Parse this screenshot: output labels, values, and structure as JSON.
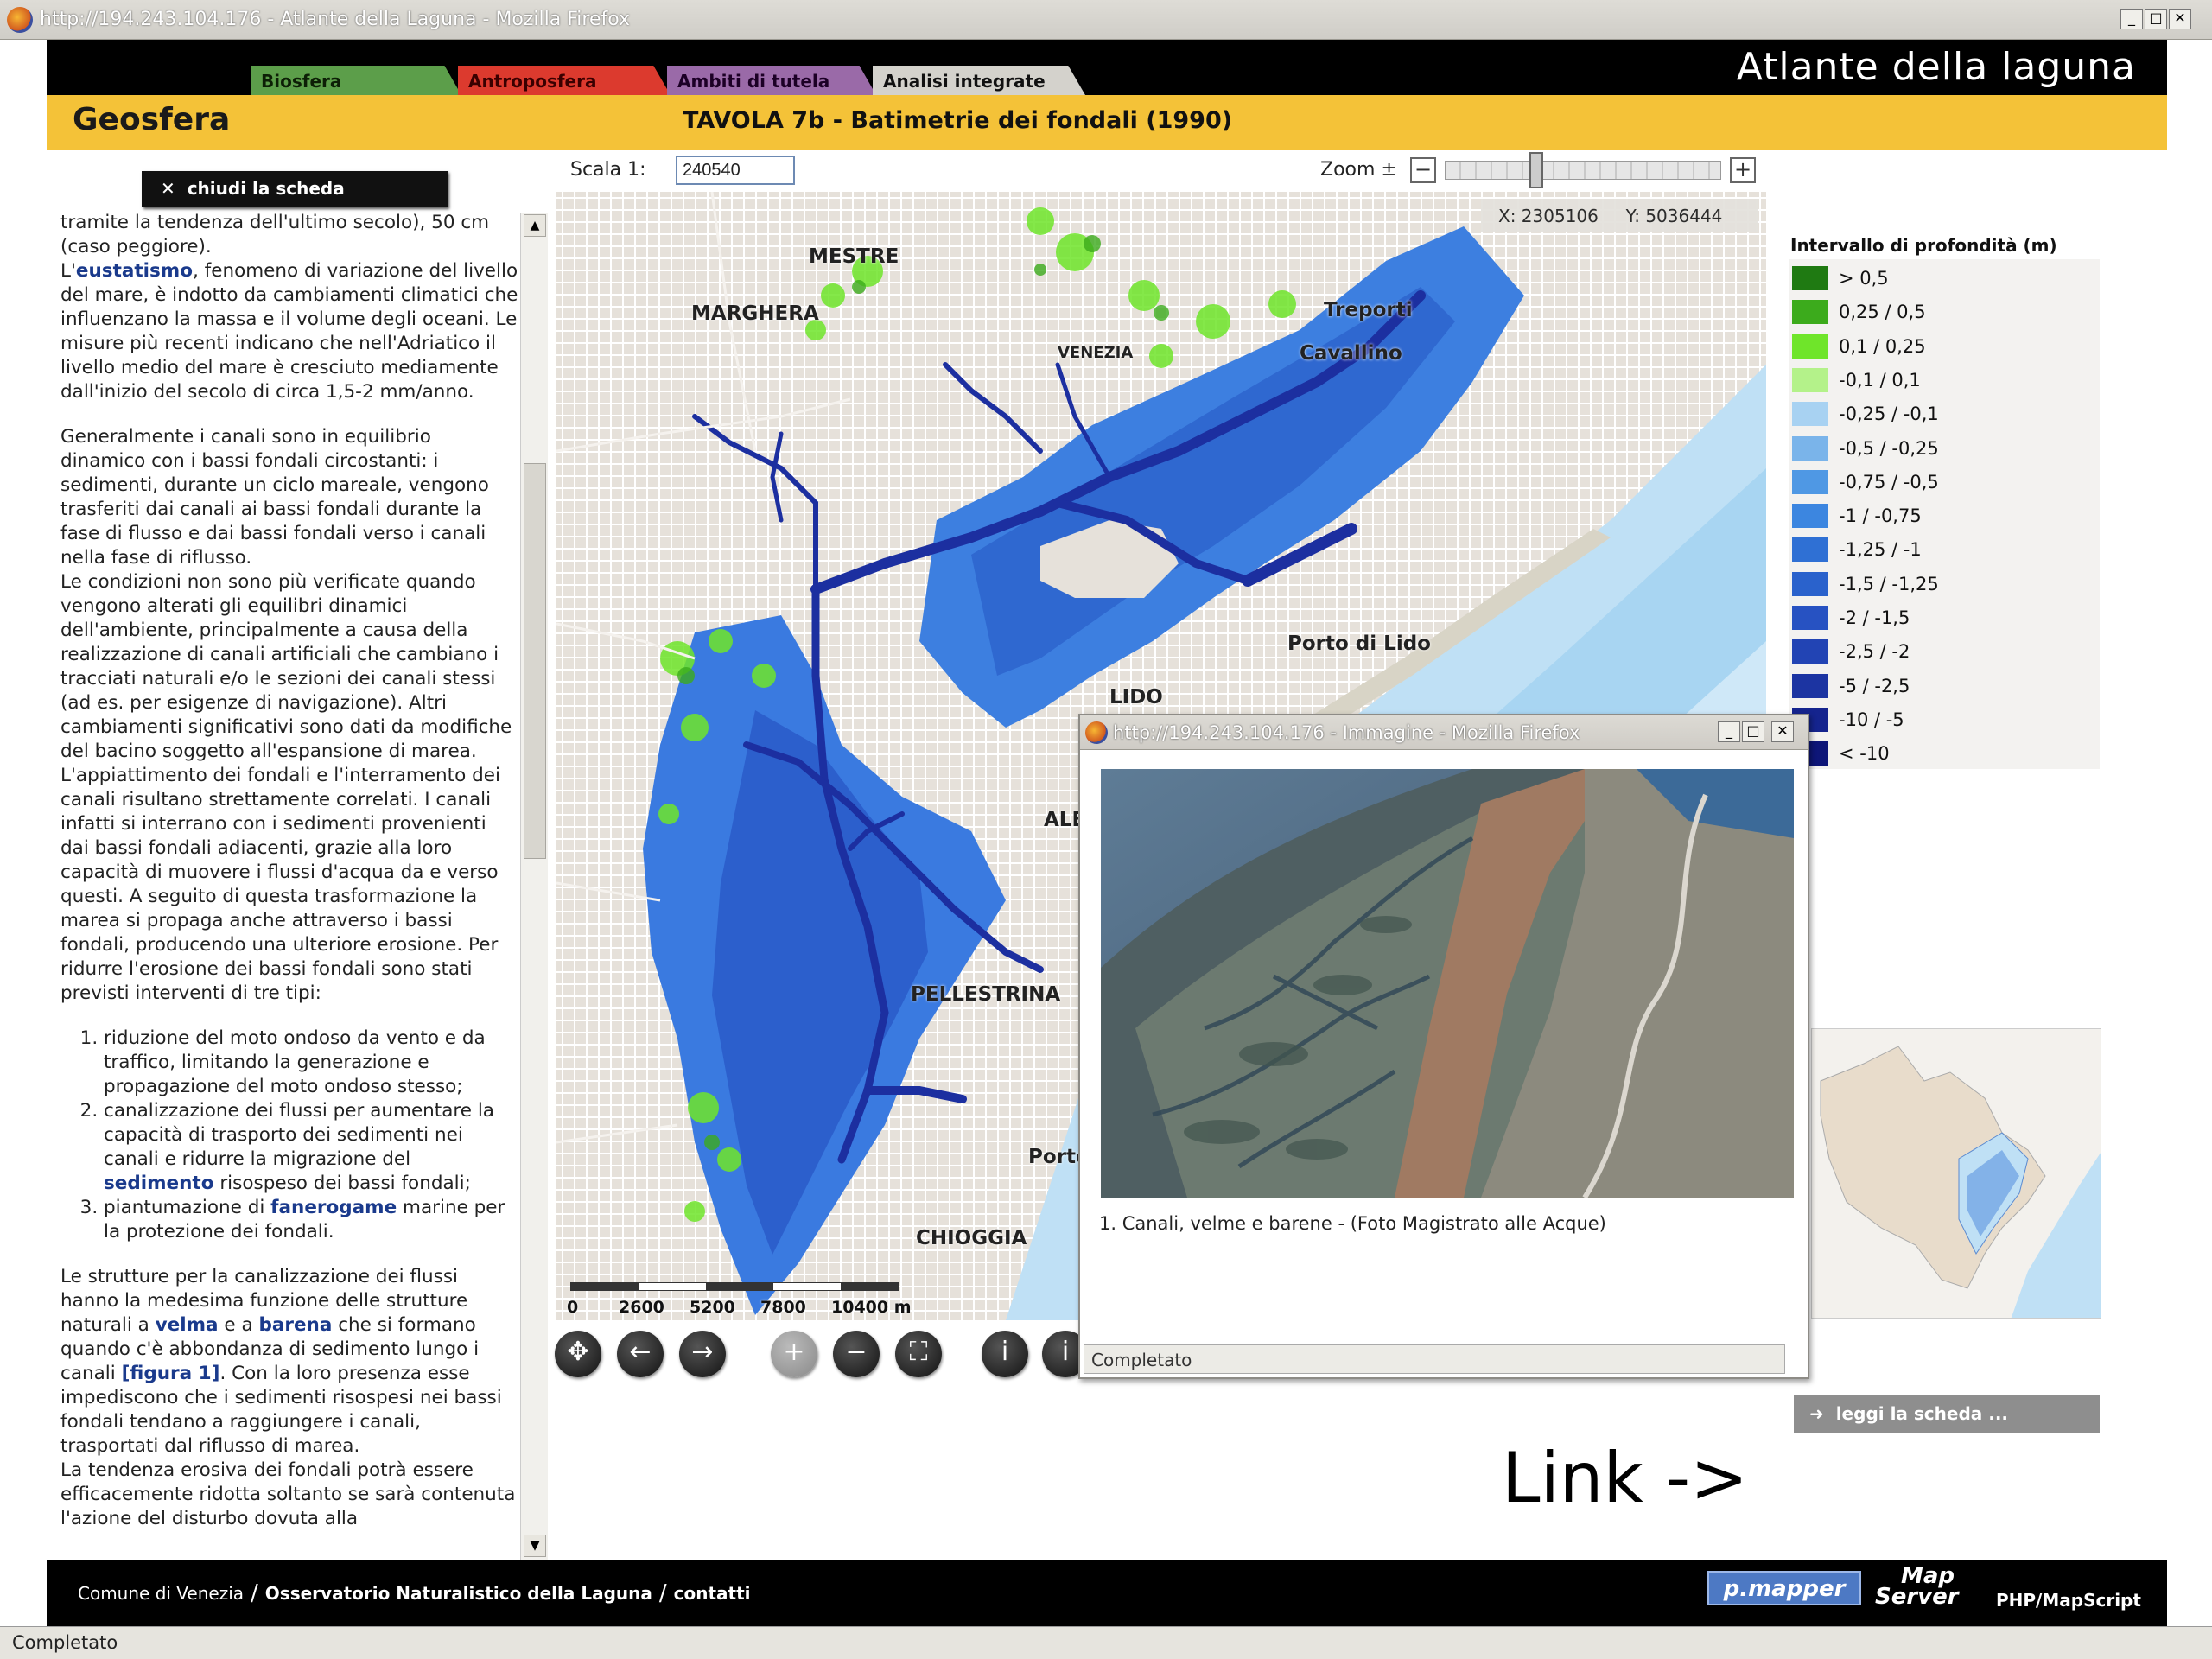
{
  "browser": {
    "title": "http://194.243.104.176 - Atlante della Laguna - Mozilla Firefox",
    "status": "Completato"
  },
  "header": {
    "brand": "Atlante della laguna",
    "tabs": [
      {
        "label": "Biosfera",
        "color": "#5c9e4a"
      },
      {
        "label": "Antroposfera",
        "color": "#dc3a2e"
      },
      {
        "label": "Ambiti di tutela",
        "color": "#9a6aa8"
      },
      {
        "label": "Analisi integrate",
        "color": "#d4d2cc"
      }
    ],
    "section": "Geosfera",
    "map_title": "TAVOLA 7b - Batimetrie dei fondali (1990)"
  },
  "text_panel": {
    "close_label": "chiudi la scheda",
    "p0": "tramite la tendenza dell'ultimo secolo), 50 cm (caso peggiore).",
    "p1_pre": "L'",
    "p1_kw": "eustatismo",
    "p1_post": ", fenomeno di variazione del livello del mare, è indotto da cambiamenti climatici che influenzano la massa e il volume degli oceani. Le misure più recenti indicano che nell'Adriatico il livello medio del mare è cresciuto mediamente dall'inizio del secolo di circa 1,5-2 mm/anno.",
    "p2": "Generalmente i canali sono in equilibrio dinamico con i bassi fondali circostanti: i sedimenti, durante un ciclo mareale, vengono trasferiti dai canali ai bassi fondali durante la fase di flusso e dai bassi fondali verso i canali nella fase di riflusso.",
    "p3": "Le condizioni non sono più verificate quando vengono alterati gli equilibri dinamici dell'ambiente, principalmente a causa della realizzazione di canali artificiali che cambiano i tracciati naturali e/o le sezioni dei canali stessi (ad es. per esigenze di navigazione). Altri cambiamenti significativi sono dati da modifiche del bacino soggetto all'espansione di marea. L'appiattimento dei fondali e l'interramento dei canali risultano strettamente correlati. I canali infatti si interrano con i sedimenti provenienti dai bassi fondali adiacenti, grazie alla loro capacità di muovere i flussi d'acqua da e verso questi. A seguito di questa trasformazione la marea si propaga anche attraverso i bassi fondali, producendo una ulteriore erosione. Per ridurre l'erosione dei bassi fondali sono stati previsti interventi di tre tipi:",
    "li1": "riduzione del moto ondoso da vento e da traffico, limitando la generazione e propagazione del moto ondoso stesso;",
    "li2_pre": "canalizzazione dei flussi per aumentare la capacità di trasporto dei sedimenti nei canali e ridurre la migrazione del ",
    "li2_kw": "sedimento",
    "li2_post": " risospeso dei bassi fondali;",
    "li3_pre": "piantumazione di ",
    "li3_kw": "fanerogame",
    "li3_post": " marine per la protezione dei fondali.",
    "p4_a": "Le strutture per la canalizzazione dei flussi hanno la medesima funzione delle strutture naturali a ",
    "p4_kw1": "velma",
    "p4_b": " e a ",
    "p4_kw2": "barena",
    "p4_c": " che si formano quando c'è abbondanza di sedimento lungo i canali ",
    "p4_kw3": "[figura 1]",
    "p4_d": ". Con la loro presenza esse impediscono che i sedimenti risospesi nei bassi fondali tendano a raggiungere i canali, trasportati dal riflusso di marea.",
    "p5": "La tendenza erosiva dei fondali potrà essere efficacemente ridotta soltanto se sarà contenuta l'azione del disturbo dovuta alla"
  },
  "map_controls": {
    "scale_label": "Scala 1:",
    "scale_value": "240540",
    "zoom_label": "Zoom ±",
    "zoom_out": "−",
    "zoom_in": "+",
    "zoom_level": 0.33,
    "coords": {
      "x": "X: 2305106",
      "y": "Y: 5036444"
    }
  },
  "map": {
    "places": [
      "MESTRE",
      "MARGHERA",
      "Treporti",
      "VENEZIA",
      "Cavallino",
      "Porto di Lido",
      "LIDO",
      "ALB",
      "PELLESTRINA",
      "Porto",
      "CHIOGGIA"
    ],
    "scale_ticks": [
      "0",
      "2600",
      "5200",
      "7800",
      "10400 m"
    ]
  },
  "legend": {
    "title": "Intervallo di profondità (m)",
    "items": [
      {
        "label": "> 0,5",
        "color": "#1f7a12"
      },
      {
        "label": "0,25 / 0,5",
        "color": "#3cab1c"
      },
      {
        "label": "0,1 / 0,25",
        "color": "#6fe52a"
      },
      {
        "label": "-0,1 / 0,1",
        "color": "#b4f28a"
      },
      {
        "label": "-0,25 / -0,1",
        "color": "#a8d2f2"
      },
      {
        "label": "-0,5 / -0,25",
        "color": "#7ab4ea"
      },
      {
        "label": "-0,75 / -0,5",
        "color": "#4f98e4"
      },
      {
        "label": "-1 / -0,75",
        "color": "#3c86e0"
      },
      {
        "label": "-1,25 / -1",
        "color": "#2f70d4"
      },
      {
        "label": "-1,5 / -1,25",
        "color": "#2a62cc"
      },
      {
        "label": "-2 / -1,5",
        "color": "#2752c2"
      },
      {
        "label": "-2,5 / -2",
        "color": "#2244b4"
      },
      {
        "label": "-5 / -2,5",
        "color": "#1c34a2"
      },
      {
        "label": "-10 / -5",
        "color": "#15248e"
      },
      {
        "label": "< -10",
        "color": "#0e1678"
      }
    ]
  },
  "right_panel": {
    "leggi_label": "leggi la scheda ...",
    "link_annotation": "Link ->"
  },
  "popup": {
    "title": "http://194.243.104.176 - Immagine - Mozilla Firefox",
    "caption": "1. Canali, velme e barene - (Foto Magistrato alle Acque)",
    "status": "Completato"
  },
  "footer": {
    "comune": "Comune di Venezia",
    "osservatorio": "Osservatorio Naturalistico della Laguna",
    "contatti": "contatti",
    "pmapper": "p.mapper",
    "mapserver_a": "Map",
    "mapserver_b": "Server",
    "phpmapscript": "PHP/MapScript"
  }
}
